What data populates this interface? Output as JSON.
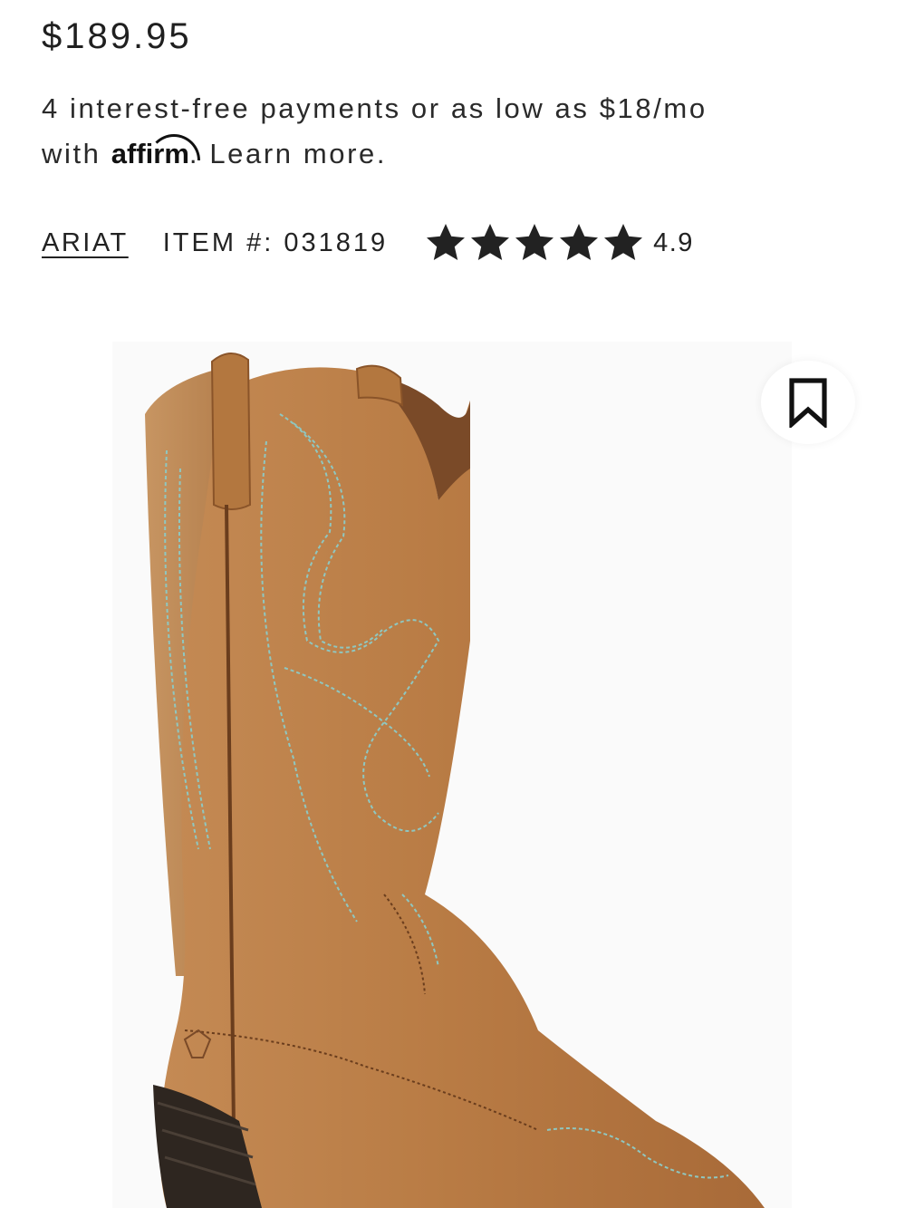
{
  "price": "$189.95",
  "financing": {
    "line1": "4 interest-free payments or as low as $18/mo",
    "with": "with",
    "provider": "affirm",
    "learn_more": ". Learn more."
  },
  "product": {
    "brand": "ARIAT",
    "item_number_label": "ITEM #: 031819",
    "rating": "4.9",
    "rating_value": 4.9,
    "rating_max": 5
  },
  "image": {
    "icon": "bookmark-icon",
    "subject": "boot-image"
  },
  "colors": {
    "text": "#222222",
    "leather": "#b87a45",
    "stitch": "#8fc7c0"
  }
}
